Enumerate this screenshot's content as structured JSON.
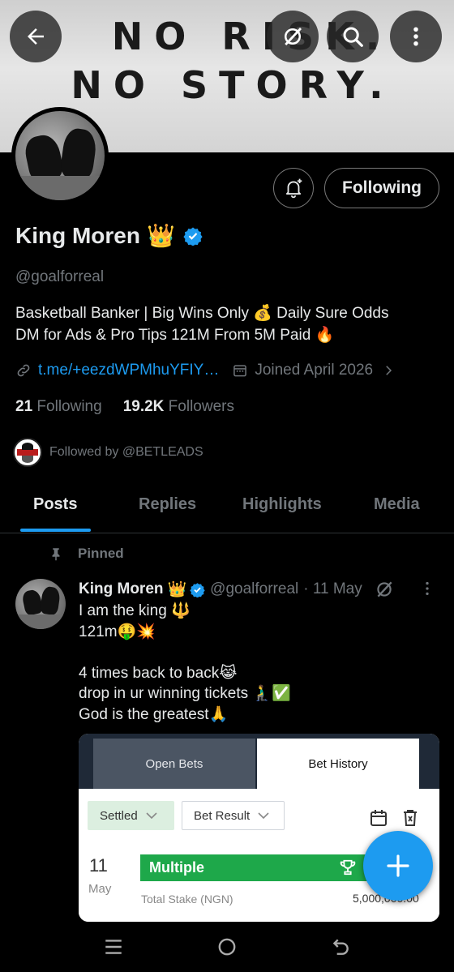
{
  "banner": {
    "line1": "NO RISK.",
    "line2": "NO STORY."
  },
  "header": {
    "back_icon": "arrow-left-icon",
    "grok_icon": "grok-icon",
    "search_icon": "search-icon",
    "more_icon": "more-vertical-icon"
  },
  "profile": {
    "name": "King Moren",
    "name_emoji": "👑",
    "handle": "@goalforreal",
    "bio_line1": "Basketball Banker | Big Wins Only 💰 Daily Sure Odds",
    "bio_line2": "DM for Ads & Pro Tips 121M From 5M Paid 🔥",
    "link": "t.me/+eezdWPMhuYFIY…",
    "joined": "Joined April 2026",
    "following_count": "21",
    "following_label": "Following",
    "followers_count": "19.2K",
    "followers_label": "Followers",
    "followed_by": "Followed by @BETLEADS",
    "follow_button": "Following",
    "verified_color": "#1d9bf0"
  },
  "tabs": [
    {
      "label": "Posts",
      "active": true
    },
    {
      "label": "Replies",
      "active": false
    },
    {
      "label": "Highlights",
      "active": false
    },
    {
      "label": "Media",
      "active": false
    }
  ],
  "post": {
    "pinned_label": "Pinned",
    "author_name": "King Moren",
    "author_emoji": "👑",
    "author_handle": "@goalforreal",
    "date": "· 11 May",
    "lines": [
      "I am the king 🔱",
      "121m🤑💥",
      "",
      "4 times back to back😹",
      "drop in ur winning tickets 🧎‍♂️✅",
      "God is the greatest🙏"
    ],
    "media": {
      "tab_open": "Open Bets",
      "tab_history": "Bet History",
      "filter_settled": "Settled",
      "filter_result": "Bet Result",
      "bet_day": "11",
      "bet_month": "May",
      "bet_type": "Multiple",
      "stake_label": "Total Stake (NGN)",
      "stake_amount": "5,000,000.00"
    }
  },
  "colors": {
    "accent": "#1d9bf0",
    "background": "#000000",
    "muted": "#71767b"
  }
}
